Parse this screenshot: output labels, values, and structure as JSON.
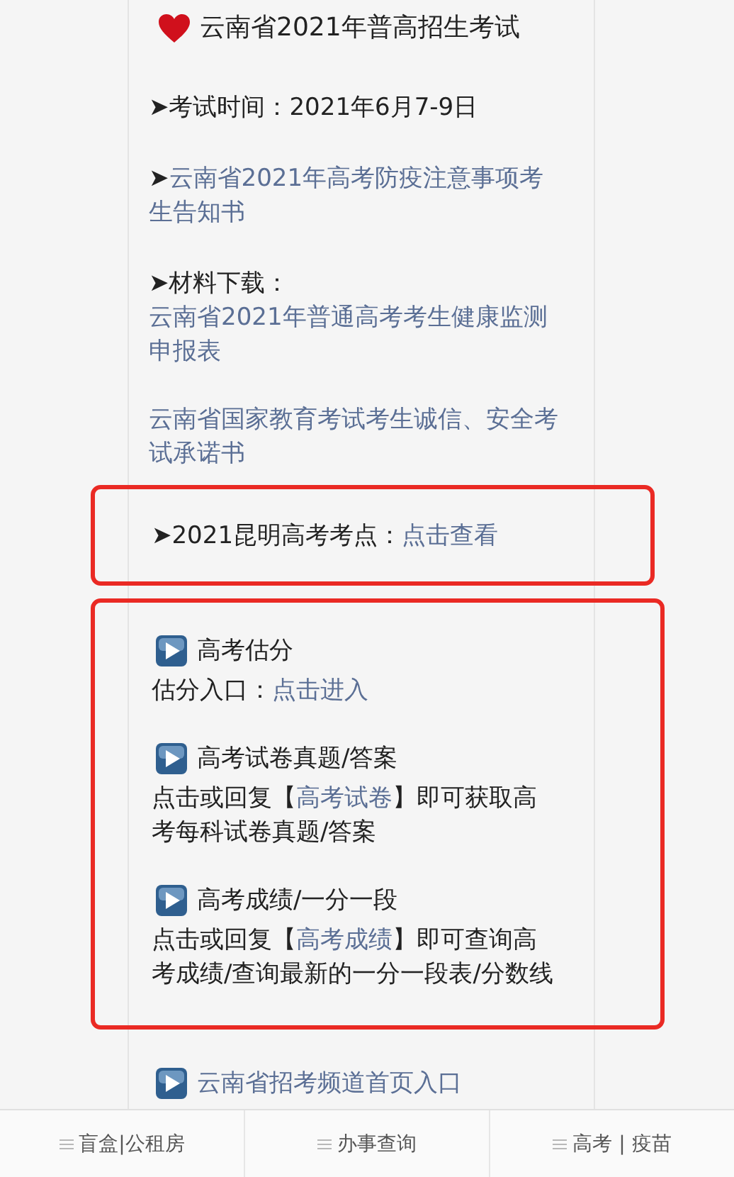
{
  "title": "云南省2021年普高招生考试",
  "exam_time": "➤考试时间：2021年6月7-9日",
  "notice": {
    "bullet": "➤",
    "link": "云南省2021年高考防疫注意事项考生告知书"
  },
  "materials": {
    "label": "➤材料下载：",
    "links": [
      "云南省2021年普通高考考生健康监测申报表",
      "云南省国家教育考试考生诚信、安全考试承诺书"
    ]
  },
  "exam_sites": {
    "label": "➤2021昆明高考考点：",
    "link": "点击查看"
  },
  "services": [
    {
      "heading": "高考估分",
      "before": "估分入口：",
      "link": "点击进入"
    },
    {
      "heading": "高考试卷真题/答案",
      "before": "点击或回复【",
      "link": "高考试卷",
      "after": "】即可获取高考每科试卷真题/答案"
    },
    {
      "heading": "高考成绩/一分一段",
      "before": "点击或回复【",
      "link": "高考成绩",
      "after": "】即可查询高考成绩/查询最新的一分一段表/分数线"
    }
  ],
  "home_link": "云南省招考频道首页入口",
  "bottom_nav": [
    "盲盒|公租房",
    "办事查询",
    "高考 | 疫苗"
  ]
}
